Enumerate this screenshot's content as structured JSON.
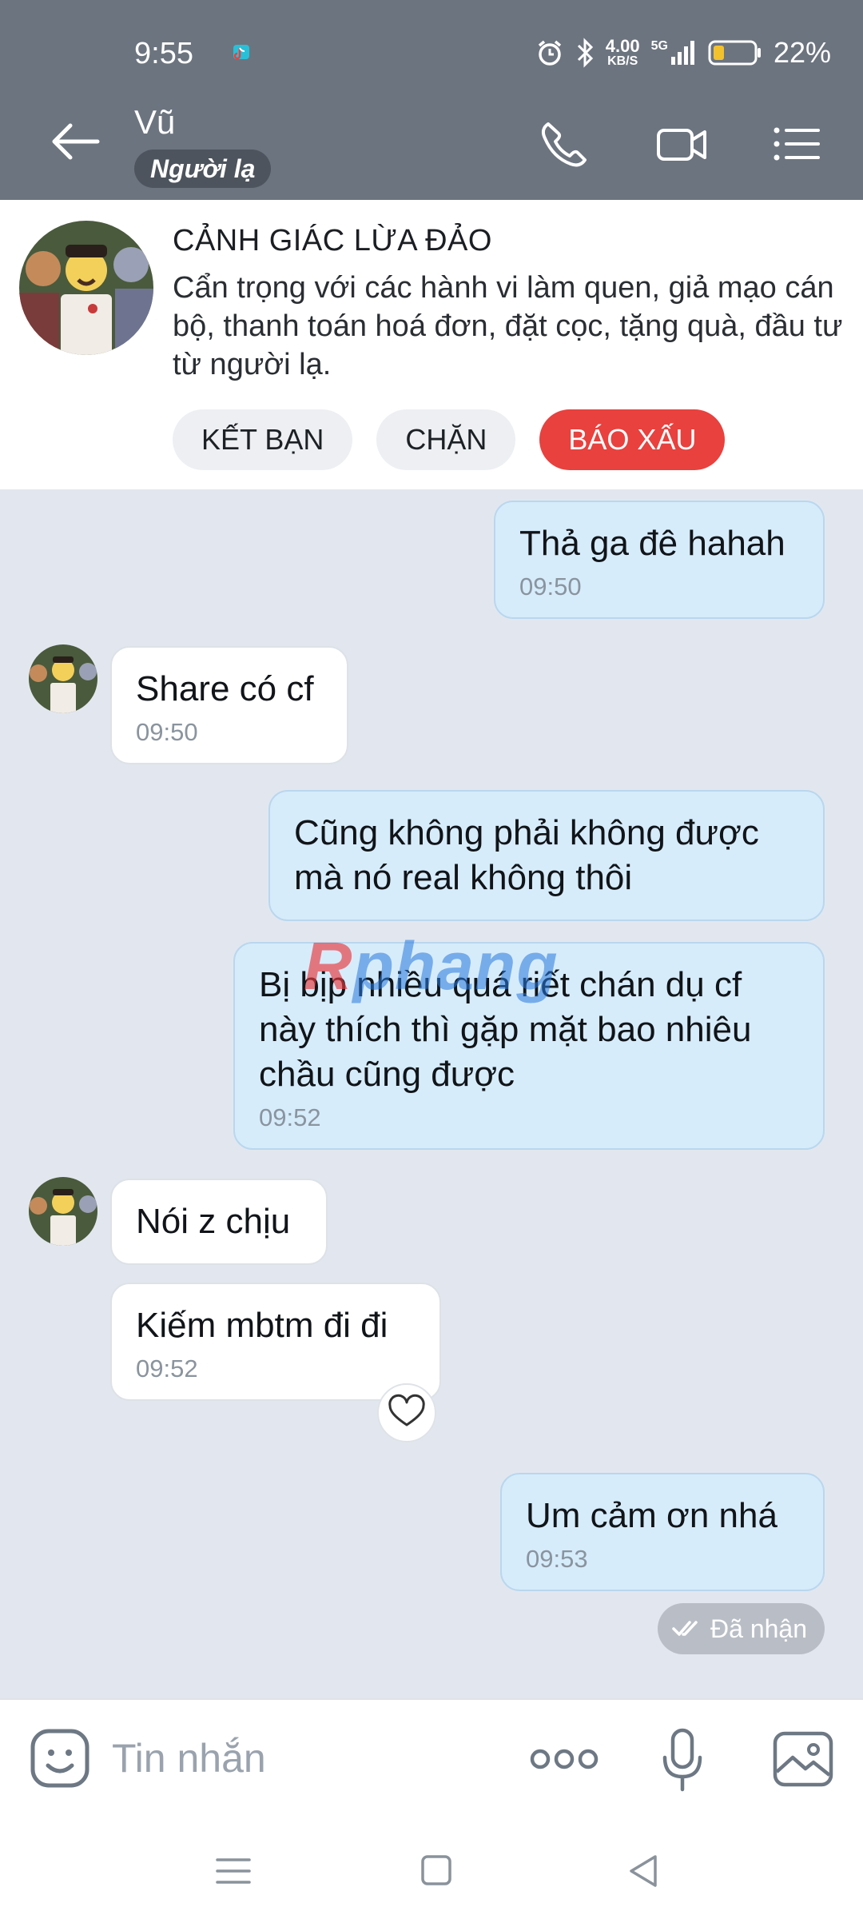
{
  "status_bar": {
    "time": "9:55",
    "net_speed_value": "4.00",
    "net_speed_unit": "KB/S",
    "network": "5G",
    "battery_pct": "22%",
    "icons": [
      "tiktok-notification-icon",
      "alarm-icon",
      "bluetooth-icon",
      "signal-icon",
      "battery-icon"
    ]
  },
  "header": {
    "name": "Vũ",
    "tag": "Người lạ",
    "icons": [
      "back-arrow-icon",
      "phone-icon",
      "video-call-icon",
      "menu-icon"
    ]
  },
  "warning": {
    "title": "CẢNH GIÁC LỪA ĐẢO",
    "text": "Cẩn trọng với các hành vi làm quen, giả mạo cán bộ, thanh toán hoá đơn, đặt cọc, tặng quà, đầu tư từ người lạ.",
    "buttons": {
      "add_friend": "KẾT BẠN",
      "block": "CHẶN",
      "report": "BÁO XẤU"
    }
  },
  "messages": [
    {
      "from": "me",
      "text": "Thả ga đê hahah",
      "time": "09:50"
    },
    {
      "from": "them",
      "text": "Share có cf",
      "time": "09:50"
    },
    {
      "from": "me",
      "text": "Cũng không phải không được mà nó real không thôi",
      "time": ""
    },
    {
      "from": "me",
      "text": "Bị bịp nhiều quá riết chán dụ cf này thích thì gặp mặt bao nhiêu chầu cũng được",
      "time": "09:52"
    },
    {
      "from": "them",
      "text": "Nói z chịu",
      "time": ""
    },
    {
      "from": "them",
      "text": "Kiếm mbtm đi đi",
      "time": "09:52"
    },
    {
      "from": "me",
      "text": "Um cảm ơn nhá",
      "time": "09:53"
    }
  ],
  "seen_status": "Đã nhận",
  "watermark": {
    "part1": "R",
    "part2": "phang"
  },
  "composer": {
    "placeholder": "Tin nhắn",
    "icons": [
      "emoji-icon",
      "more-icon",
      "microphone-icon",
      "image-icon"
    ]
  },
  "nav": {
    "icons": [
      "recents-icon",
      "home-icon",
      "back-icon"
    ]
  },
  "colors": {
    "header_bg": "#6c747f",
    "chat_bg": "#e2e7ef",
    "my_bubble": "#d6ecfb",
    "their_bubble": "#ffffff",
    "report_button": "#e8413e"
  }
}
